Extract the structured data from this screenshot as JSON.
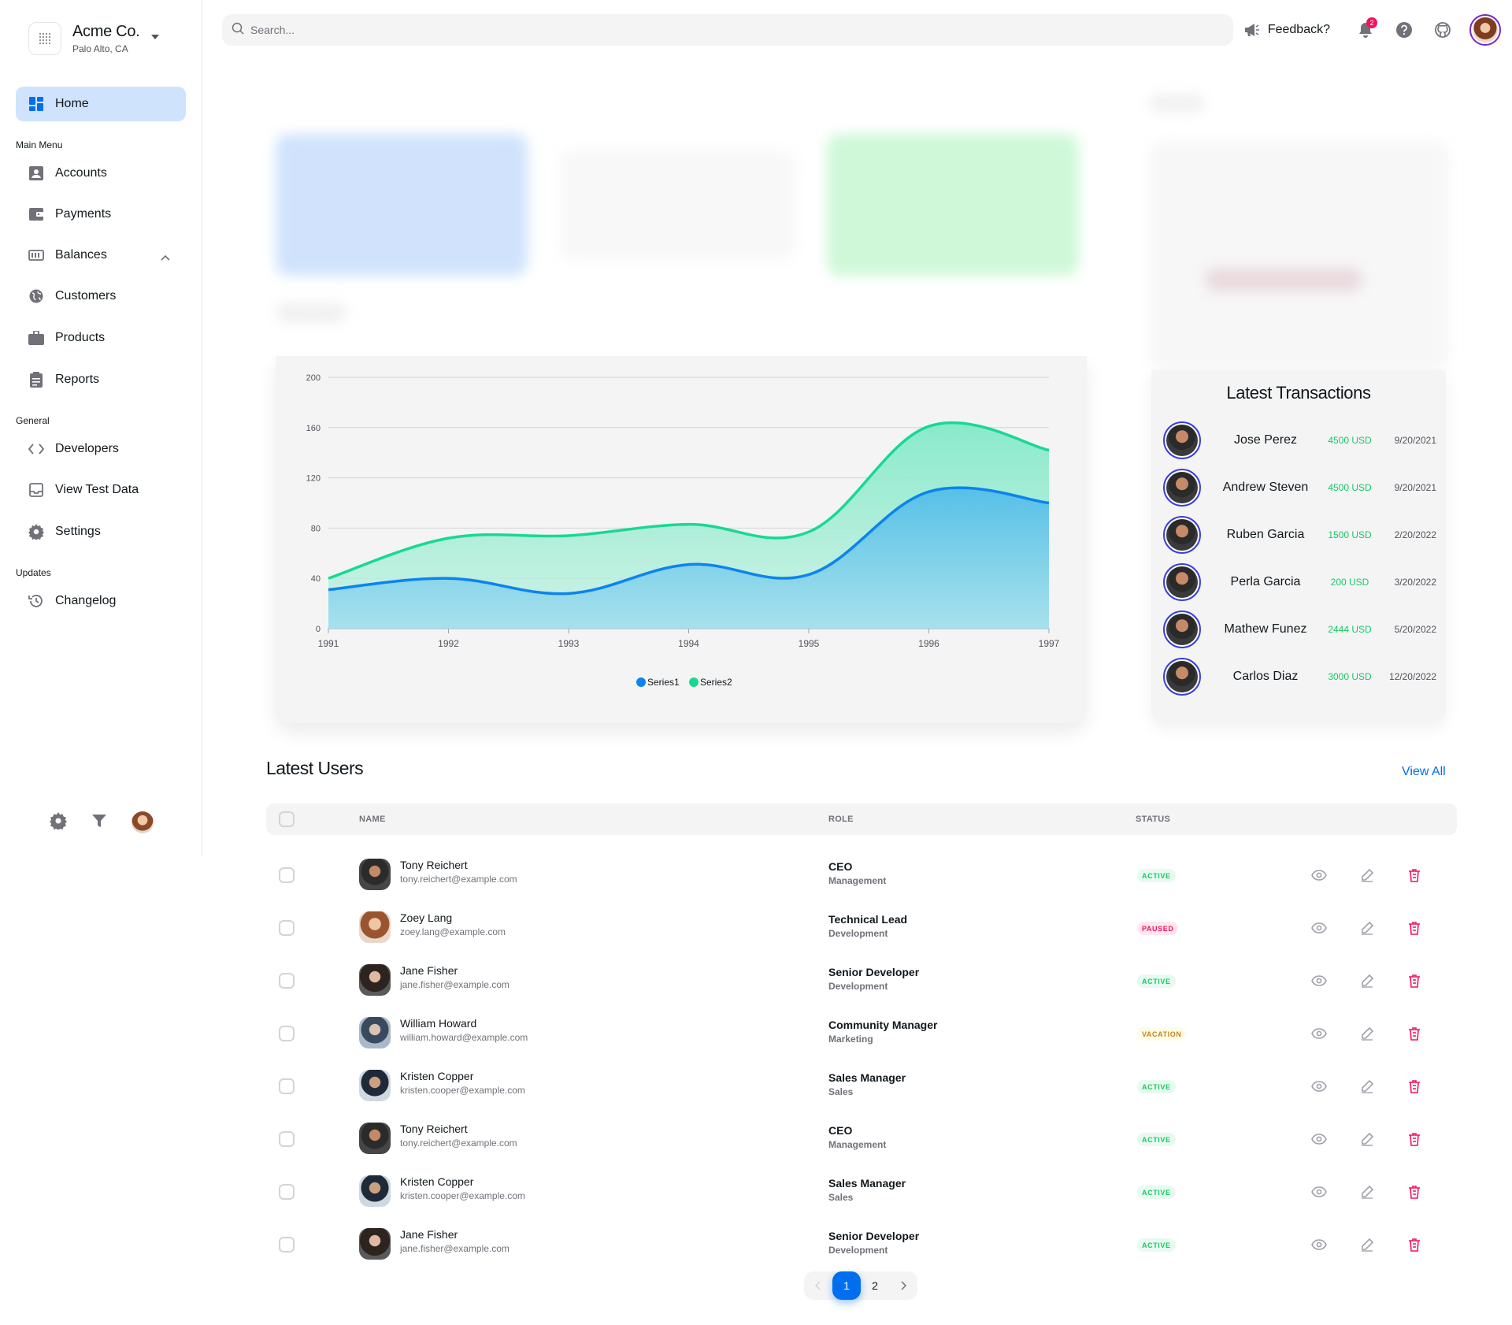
{
  "company": {
    "name": "Acme Co.",
    "location": "Palo Alto, CA"
  },
  "sidebar": {
    "home_label": "Home",
    "sections": {
      "main_menu": "Main Menu",
      "general": "General",
      "updates": "Updates"
    },
    "main_items": [
      "Accounts",
      "Payments",
      "Balances",
      "Customers",
      "Products",
      "Reports"
    ],
    "general_items": [
      "Developers",
      "View Test Data",
      "Settings"
    ],
    "updates_items": [
      "Changelog"
    ]
  },
  "topbar": {
    "search_placeholder": "Search...",
    "feedback_label": "Feedback?",
    "notification_count": "2"
  },
  "colors": {
    "accent": "#006fee",
    "series1": "#0b84f0",
    "series2": "#17d992",
    "active_status": "#17c964",
    "paused_status": "#f31260",
    "vacation_status": "#c4841d"
  },
  "chart_data": {
    "type": "area",
    "x": [
      "1991",
      "1992",
      "1993",
      "1994",
      "1995",
      "1996",
      "1997"
    ],
    "ylim": [
      0,
      200
    ],
    "yticks": [
      "0",
      "40",
      "80",
      "120",
      "160",
      "200"
    ],
    "grid": true,
    "legend_position": "bottom-center",
    "series": [
      {
        "name": "Series1",
        "values": [
          31,
          40,
          28,
          51,
          43,
          109,
          100
        ]
      },
      {
        "name": "Series2",
        "values": [
          40,
          72,
          74,
          83,
          77,
          161,
          142
        ]
      }
    ]
  },
  "transactions": {
    "title": "Latest Transactions",
    "items": [
      {
        "name": "Jose Perez",
        "amount": "4500 USD",
        "date": "9/20/2021"
      },
      {
        "name": "Andrew Steven",
        "amount": "4500 USD",
        "date": "9/20/2021"
      },
      {
        "name": "Ruben Garcia",
        "amount": "1500 USD",
        "date": "2/20/2022"
      },
      {
        "name": "Perla Garcia",
        "amount": "200 USD",
        "date": "3/20/2022"
      },
      {
        "name": "Mathew Funez",
        "amount": "2444 USD",
        "date": "5/20/2022"
      },
      {
        "name": "Carlos Diaz",
        "amount": "3000 USD",
        "date": "12/20/2022"
      }
    ]
  },
  "users": {
    "title": "Latest Users",
    "view_all": "View All",
    "columns": [
      "NAME",
      "ROLE",
      "STATUS"
    ],
    "rows": [
      {
        "name": "Tony Reichert",
        "email": "tony.reichert@example.com",
        "role": "CEO",
        "team": "Management",
        "status": "ACTIVE",
        "kind": "active"
      },
      {
        "name": "Zoey Lang",
        "email": "zoey.lang@example.com",
        "role": "Technical Lead",
        "team": "Development",
        "status": "PAUSED",
        "kind": "paused"
      },
      {
        "name": "Jane Fisher",
        "email": "jane.fisher@example.com",
        "role": "Senior Developer",
        "team": "Development",
        "status": "ACTIVE",
        "kind": "active"
      },
      {
        "name": "William Howard",
        "email": "william.howard@example.com",
        "role": "Community Manager",
        "team": "Marketing",
        "status": "VACATION",
        "kind": "vacation"
      },
      {
        "name": "Kristen Copper",
        "email": "kristen.cooper@example.com",
        "role": "Sales Manager",
        "team": "Sales",
        "status": "ACTIVE",
        "kind": "active"
      },
      {
        "name": "Tony Reichert",
        "email": "tony.reichert@example.com",
        "role": "CEO",
        "team": "Management",
        "status": "ACTIVE",
        "kind": "active"
      },
      {
        "name": "Kristen Copper",
        "email": "kristen.cooper@example.com",
        "role": "Sales Manager",
        "team": "Sales",
        "status": "ACTIVE",
        "kind": "active"
      },
      {
        "name": "Jane Fisher",
        "email": "jane.fisher@example.com",
        "role": "Senior Developer",
        "team": "Development",
        "status": "ACTIVE",
        "kind": "active"
      }
    ]
  },
  "pagination": {
    "pages": [
      "1",
      "2"
    ],
    "current": "1"
  }
}
